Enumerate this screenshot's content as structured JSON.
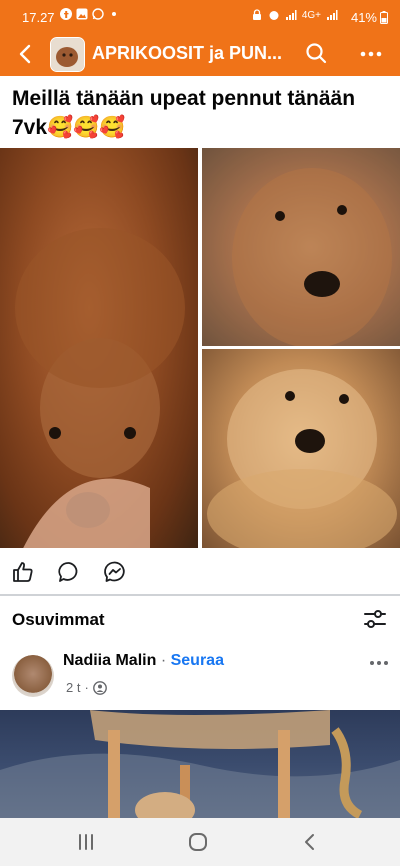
{
  "status_bar": {
    "time": "17.27",
    "network": "4G+",
    "battery": "41%"
  },
  "header": {
    "group_title": "APRIKOOSIT ja PUN...",
    "icons": [
      "back-arrow-icon",
      "search-icon",
      "more-icon"
    ]
  },
  "post": {
    "text": "Meillä tänään upeat pennut tänään 7vk🥰🥰🥰",
    "photos": [
      "puppy-photo-1",
      "puppy-photo-2",
      "puppy-photo-3"
    ],
    "action_icons": [
      "like-icon",
      "comment-icon",
      "messenger-icon"
    ]
  },
  "comments": {
    "sort_label": "Osuvimmat",
    "first": {
      "name": "Nadiia Malin",
      "separator": "·",
      "follow_label": "Seuraa",
      "time": "2 t",
      "meta_separator": "·"
    }
  },
  "nav_bar": {
    "icons": [
      "recent-apps-icon",
      "home-icon",
      "back-icon"
    ]
  },
  "colors": {
    "header_bg": "#f07318",
    "follow_link": "#1877f2"
  }
}
